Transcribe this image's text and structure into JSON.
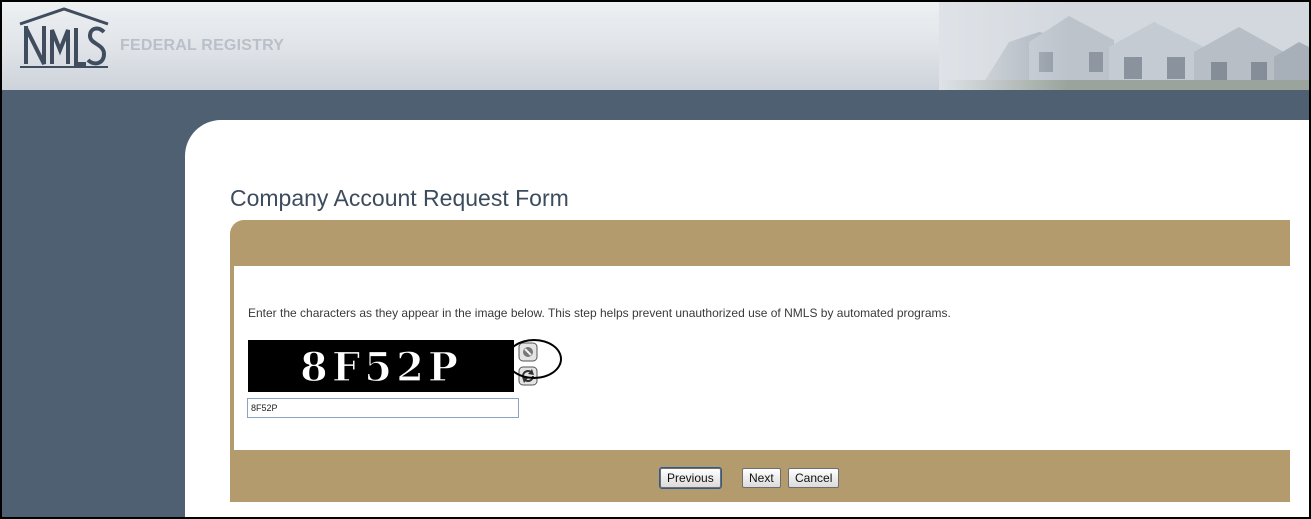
{
  "header": {
    "brand_text": "FEDERAL REGISTRY",
    "logo_icon": "nmls-logo-icon",
    "banner_image": "houses-banner-icon"
  },
  "page": {
    "title": "Company Account Request Form"
  },
  "captcha": {
    "instructions": "Enter the characters as they appear in the image below. This step helps prevent unauthorized use of NMLS by automated programs.",
    "image_text": "8F52P",
    "input_value": "8F52P",
    "audio_icon": "audio-icon",
    "refresh_icon": "refresh-icon"
  },
  "buttons": {
    "previous_label": "Previous",
    "next_label": "Next",
    "cancel_label": "Cancel"
  },
  "colors": {
    "side_band": "#4f6072",
    "panel_tan": "#b39b6d",
    "title_text": "#3d4c5d"
  }
}
